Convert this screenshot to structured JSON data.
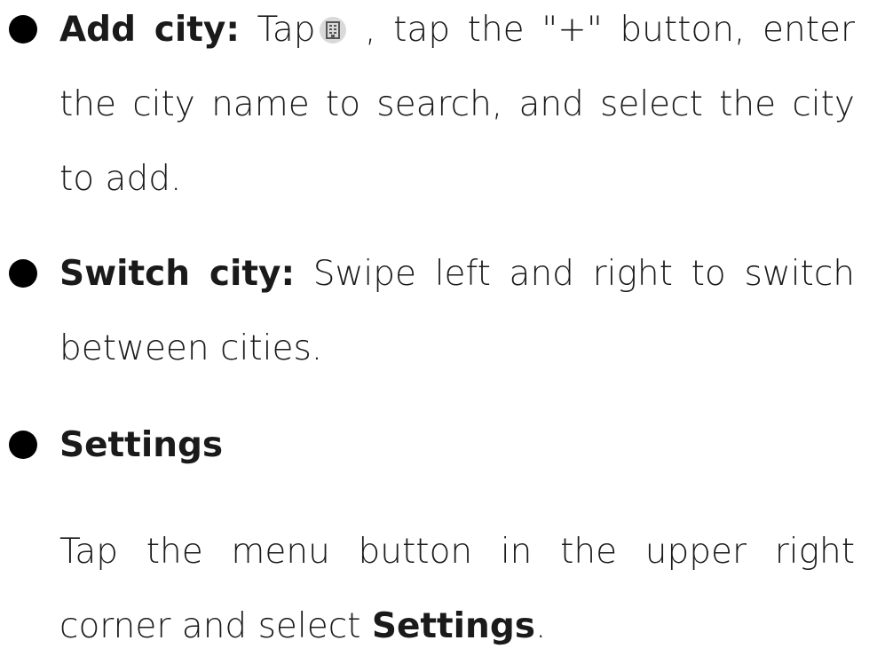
{
  "sections": [
    {
      "heading": "Add city:",
      "before_icon": "Tap",
      "icon": "city-management-icon",
      "after_icon": ", tap the \"+\" button, enter the city name to search, and select the city to add."
    },
    {
      "heading": "Switch city:",
      "text": "Swipe left and right to switch between cities."
    },
    {
      "heading": "Settings",
      "text_before": "Tap the menu button in the upper right corner and select",
      "text_bold": "Settings",
      "text_after": "."
    }
  ]
}
